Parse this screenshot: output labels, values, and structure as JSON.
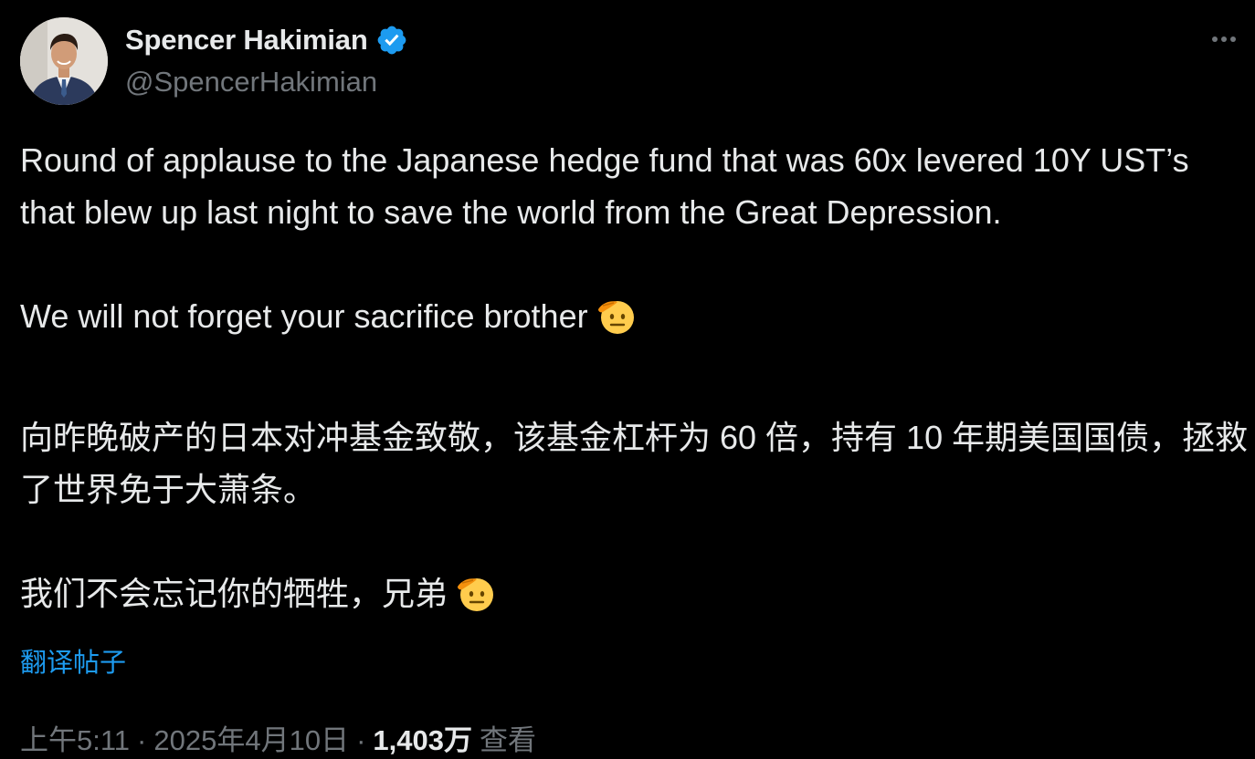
{
  "author": {
    "name": "Spencer Hakimian",
    "handle": "@SpencerHakimian",
    "verified": true
  },
  "tweet": {
    "paragraph_1": "Round of applause to the Japanese hedge fund that was 60x levered 10Y UST’s that blew up last night to save the world from the Great Depression.",
    "paragraph_2": "We will not forget your sacrifice brother",
    "emoji": "saluting-face-icon"
  },
  "translation": {
    "paragraph_1": "向昨晚破产的日本对冲基金致敬，该基金杠杆为 60 倍，持有 10 年期美国国债，拯救了世界免于大萧条。",
    "paragraph_2": "我们不会忘记你的牺牲，兄弟"
  },
  "translate_link": "翻译帖子",
  "meta": {
    "time": "上午5:11",
    "date": "2025年4月10日",
    "separator": "·",
    "views_count": "1,403万",
    "views_label": "查看"
  },
  "colors": {
    "background": "#000000",
    "text": "#e7e9ea",
    "muted": "#71767b",
    "link": "#1d9bf0",
    "verified": "#1d9bf0"
  }
}
